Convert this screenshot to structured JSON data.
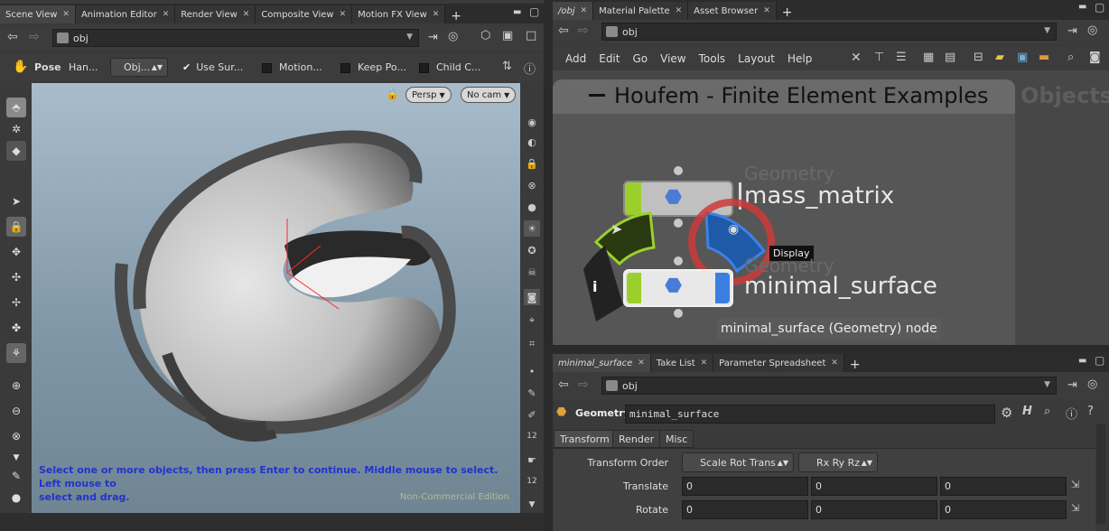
{
  "left_tabs": [
    {
      "label": "Scene View",
      "active": true
    },
    {
      "label": "Animation Editor"
    },
    {
      "label": "Render View"
    },
    {
      "label": "Composite View"
    },
    {
      "label": "Motion FX View"
    }
  ],
  "right_top_tabs": [
    {
      "label": "/obj",
      "active": true
    },
    {
      "label": "Material Palette"
    },
    {
      "label": "Asset Browser"
    }
  ],
  "scene_path": "obj",
  "network_path": "obj",
  "param_path": "obj",
  "pose_toolbar": {
    "title": "Pose",
    "handles": "Han...",
    "obj_combo": "Obj...",
    "use_surface": "Use Sur...",
    "motion": "Motion...",
    "keep_pos": "Keep Po...",
    "child_comp": "Child C..."
  },
  "viewport": {
    "persp": "Persp",
    "camera": "No cam",
    "status_line1": "Select one or more objects, then press Enter to continue. Middle mouse to select. Left mouse to",
    "status_line2": "select and drag.",
    "watermark": "Non-Commercial Edition"
  },
  "network": {
    "menus": [
      "Add",
      "Edit",
      "Go",
      "View",
      "Tools",
      "Layout",
      "Help"
    ],
    "box_title": "Houfem - Finite Element Examples",
    "context_label": "Objects",
    "node1_type": "Geometry",
    "node1_name": "mass_matrix",
    "node2_type": "Geometry",
    "node2_name": "minimal_surface",
    "tooltip": "Display",
    "node_caption": "minimal_surface (Geometry) node"
  },
  "bottom_tabs": [
    {
      "label": "minimal_surface",
      "active": true
    },
    {
      "label": "Take List"
    },
    {
      "label": "Parameter Spreadsheet"
    }
  ],
  "params": {
    "node_type": "Geometry",
    "node_name": "minimal_surface",
    "tabs": [
      "Transform",
      "Render",
      "Misc"
    ],
    "transform_order_label": "Transform Order",
    "transform_order": "Scale Rot Trans",
    "rot_order": "Rx Ry Rz",
    "translate_label": "Translate",
    "translate": [
      "0",
      "0",
      "0"
    ],
    "rotate_label": "Rotate",
    "rotate": [
      "0",
      "0",
      "0"
    ]
  },
  "colors": {
    "accent_green": "#8fd11e",
    "display_blue": "#1e5aa8",
    "panel": "#3a3a3a"
  }
}
